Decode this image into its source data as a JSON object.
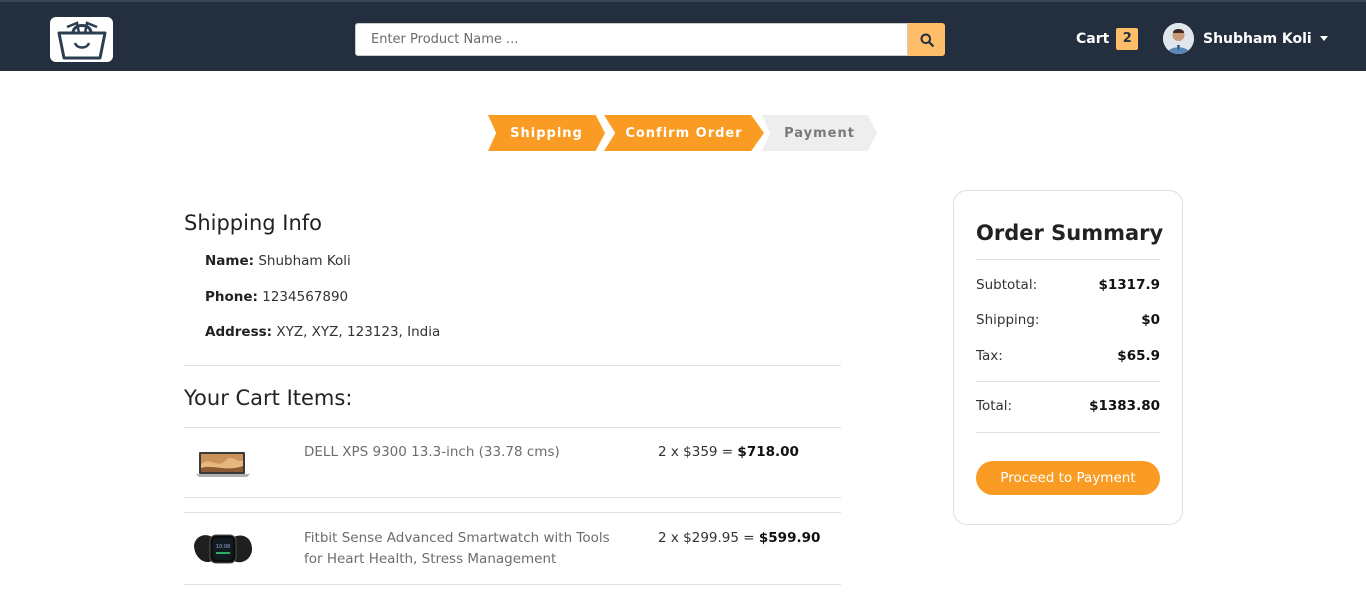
{
  "navbar": {
    "search": {
      "placeholder": "Enter Product Name ..."
    },
    "cart": {
      "label": "Cart",
      "count": "2"
    },
    "user": {
      "name": "Shubham Koli"
    },
    "colors": {
      "background": "#232f3e",
      "accent": "#febd69"
    }
  },
  "steps": [
    {
      "label": "Shipping",
      "state": "active"
    },
    {
      "label": "Confirm Order",
      "state": "active"
    },
    {
      "label": "Payment",
      "state": "inactive"
    }
  ],
  "shipping_info": {
    "title": "Shipping Info",
    "name_label": "Name:",
    "name": "Shubham Koli",
    "phone_label": "Phone:",
    "phone": "1234567890",
    "address_label": "Address:",
    "address": "XYZ, XYZ, 123123, India"
  },
  "cart_items": {
    "title": "Your Cart Items:",
    "items": [
      {
        "name": "DELL XPS 9300 13.3-inch (33.78 cms)",
        "qty_price": "2 x $359 = ",
        "total": "$718.00",
        "image_icon": "laptop-icon"
      },
      {
        "name": "Fitbit Sense Advanced Smartwatch with Tools for Heart Health, Stress Management",
        "qty_price": "2 x $299.95 = ",
        "total": "$599.90",
        "image_icon": "smartwatch-icon"
      }
    ]
  },
  "order_summary": {
    "title": "Order Summary",
    "subtotal_label": "Subtotal:",
    "subtotal": "$1317.9",
    "shipping_label": "Shipping:",
    "shipping": "$0",
    "tax_label": "Tax:",
    "tax": "$65.9",
    "total_label": "Total:",
    "total": "$1383.80",
    "button": "Proceed to Payment"
  },
  "colors": {
    "accent": "#fa9c23",
    "step_inactive": "#eeeeee"
  }
}
